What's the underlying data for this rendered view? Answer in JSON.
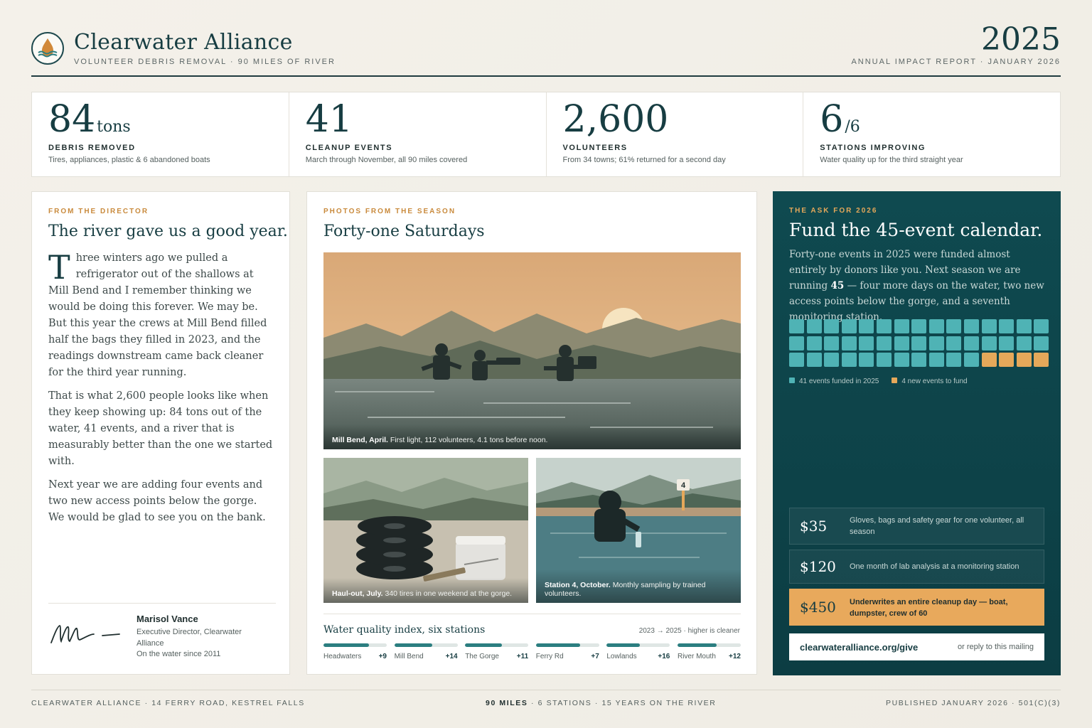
{
  "header": {
    "org_name": "Clearwater Alliance",
    "tagline": "VOLUNTEER DEBRIS REMOVAL · 90 MILES OF RIVER",
    "year": "2025",
    "report_label": "ANNUAL IMPACT REPORT · JANUARY 2026",
    "logo_icon": "water-drop-icon"
  },
  "stats": [
    {
      "value": "84",
      "unit": "tons",
      "label": "DEBRIS REMOVED",
      "desc": "Tires, appliances, plastic & 6 abandoned boats"
    },
    {
      "value": "41",
      "unit": "",
      "label": "CLEANUP EVENTS",
      "desc": "March through November, all 90 miles covered"
    },
    {
      "value": "2,600",
      "unit": "",
      "label": "VOLUNTEERS",
      "desc": "From 34 towns; 61% returned for a second day"
    },
    {
      "value": "6",
      "unit": "/6",
      "label": "STATIONS IMPROVING",
      "desc": "Water quality up for the third straight year"
    }
  ],
  "director": {
    "kicker": "FROM THE DIRECTOR",
    "title": "The river gave us a good year.",
    "dropcap": "T",
    "p1": "hree winters ago we pulled a refrigerator out of the shallows at Mill Bend and I remember thinking we would be doing this forever. We may be. But this year the crews at Mill Bend filled half the bags they filled in 2023, and the readings downstream came back cleaner for the third year running.",
    "p2": "That is what 2,600 people looks like when they keep showing up: 84 tons out of the water, 41 events, and a river that is measurably better than the one we started with.",
    "p3": "Next year we are adding four events and two new access points below the gorge. We would be glad to see you on the bank.",
    "signer_name": "Marisol Vance",
    "signer_title": "Executive Director, Clearwater Alliance",
    "signer_since": "On the water since 2011"
  },
  "photos": {
    "kicker": "PHOTOS FROM THE SEASON",
    "title": "Forty-one Saturdays",
    "main_caption_bold": "Mill Bend, April.",
    "main_caption": " First light, 112 volunteers, 4.1 tons before noon.",
    "a_caption_bold": "Haul-out, July.",
    "a_caption": " 340 tires in one weekend at the gorge.",
    "b_caption_bold": "Station 4, October.",
    "b_caption": " Monthly sampling by trained volunteers.",
    "marker_label": "4"
  },
  "water_quality": {
    "title": "Water quality index, six stations",
    "subtitle": "2023 → 2025 · higher is cleaner",
    "stations": [
      {
        "name": "Headwaters",
        "delta": "+9",
        "level": 0.72
      },
      {
        "name": "Mill Bend",
        "delta": "+14",
        "level": 0.6
      },
      {
        "name": "The Gorge",
        "delta": "+11",
        "level": 0.58
      },
      {
        "name": "Ferry Rd",
        "delta": "+7",
        "level": 0.7
      },
      {
        "name": "Lowlands",
        "delta": "+16",
        "level": 0.52
      },
      {
        "name": "River Mouth",
        "delta": "+12",
        "level": 0.62
      }
    ]
  },
  "ask": {
    "kicker": "THE ASK FOR 2026",
    "title": "Fund the 45-event calendar.",
    "body_pre": "Forty-one events in 2025 were funded almost entirely by donors like you. Next season we are running ",
    "body_bold": "45",
    "body_post": " — four more days on the water, two new access points below the gorge, and a seventh monitoring station.",
    "funded_count": 41,
    "new_count": 4,
    "legend_funded": "41 events funded in 2025",
    "legend_new": "4 new events to fund",
    "color_funded": "#4fb3b5",
    "color_new": "#e5a85a",
    "tiers": [
      {
        "amount": "$35",
        "desc": "Gloves, bags and safety gear for one volunteer, all season"
      },
      {
        "amount": "$120",
        "desc": "One month of lab analysis at a monitoring station"
      },
      {
        "amount": "$450",
        "desc": "Underwrites an entire cleanup day — boat, dumpster, crew of 60"
      }
    ],
    "give_url": "clearwateralliance.org/give",
    "give_note": "or reply to this mailing"
  },
  "footer": {
    "left": "CLEARWATER ALLIANCE · 14 FERRY ROAD, KESTREL FALLS",
    "center_bold": "90 MILES",
    "center": " · 6 STATIONS · 15 YEARS ON THE RIVER",
    "right": "PUBLISHED JANUARY 2026 · 501(C)(3)"
  }
}
